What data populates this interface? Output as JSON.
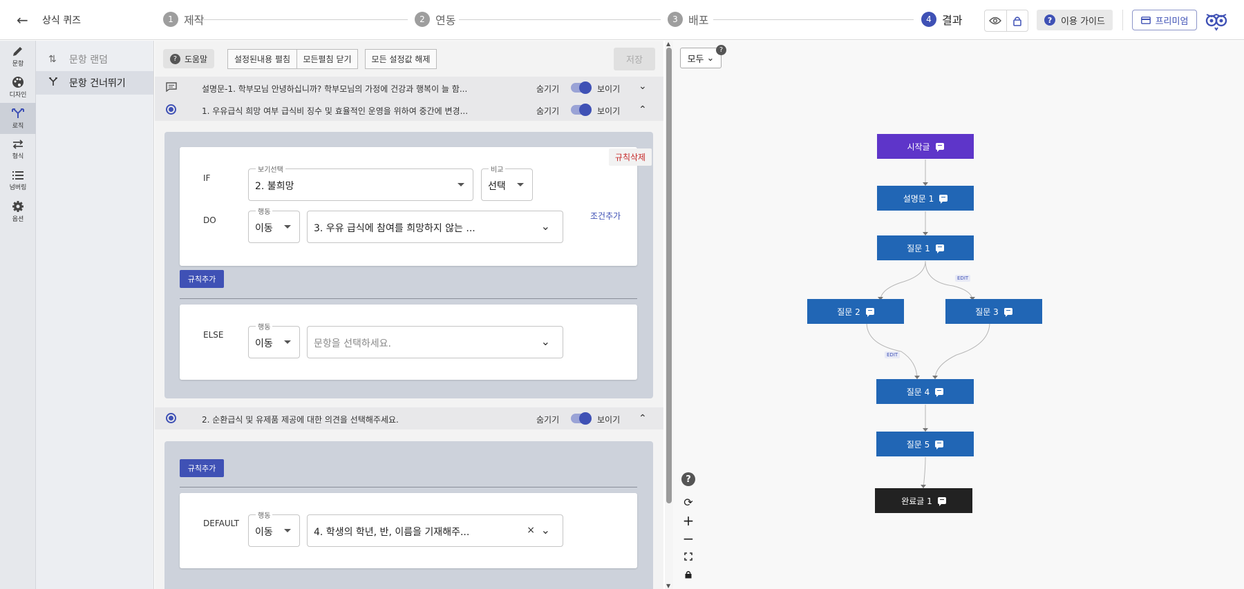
{
  "header": {
    "back_icon": "arrow-left-icon",
    "title": "상식 퀴즈",
    "steps": [
      {
        "num": "1",
        "label": "제작"
      },
      {
        "num": "2",
        "label": "연동"
      },
      {
        "num": "3",
        "label": "배포"
      },
      {
        "num": "4",
        "label": "결과"
      }
    ],
    "active_step": "4",
    "guide_label": "이용 가이드",
    "premium_label": "프리미엄",
    "accent": "#3f51b5"
  },
  "sidenav": {
    "items": [
      {
        "label": "문항",
        "icon": "pencil-icon"
      },
      {
        "label": "디자인",
        "icon": "palette-icon"
      },
      {
        "label": "로직",
        "icon": "branch-icon"
      },
      {
        "label": "형식",
        "icon": "swap-icon"
      },
      {
        "label": "넘버링",
        "icon": "list-icon"
      },
      {
        "label": "옵션",
        "icon": "gear-icon"
      }
    ],
    "active": "로직"
  },
  "subnav": {
    "items": [
      {
        "label": "문항 랜덤",
        "icon": "shuffle-icon"
      },
      {
        "label": "문항 건너뛰기",
        "icon": "skip-icon"
      }
    ]
  },
  "toolbar": {
    "help_label": "도움말",
    "expand_label": "설정된내용 펼침",
    "collapse_label": "모든펼침 닫기",
    "reset_label": "모든 설정값 해제",
    "save_label": "저장"
  },
  "rows": {
    "desc": {
      "text": "설명문-1. 학부모님 안녕하십니까? 학부모님의 가정에 건강과 행복이 늘 함...",
      "hide": "숨기기",
      "show": "보이기"
    },
    "q1": {
      "text": "1. 우유급식 희망 여부 급식비 징수 및 효율적인 운영을 위하여 중간에 변경...",
      "hide": "숨기기",
      "show": "보이기"
    },
    "q2": {
      "text": "2. 순환급식 및 유제품 제공에 대한 의견을 선택해주세요.",
      "hide": "숨기기",
      "show": "보이기"
    }
  },
  "rule1": {
    "delete_label": "규칙삭제",
    "if_label": "IF",
    "select_label": "보기선택",
    "select_value": "2. 불희망",
    "compare_label": "비교",
    "compare_value": "선택",
    "do_label": "DO",
    "action_label": "행동",
    "action_value": "이동",
    "target_value": "3. 우유 급식에 참여를 희망하지 않는 ...",
    "add_condition_label": "조건추가"
  },
  "add_rule_label": "규칙추가",
  "else_block": {
    "else_label": "ELSE",
    "action_label": "행동",
    "action_value": "이동",
    "target_placeholder": "문항을 선택하세요."
  },
  "default_block": {
    "default_label": "DEFAULT",
    "action_label": "행동",
    "action_value": "이동",
    "target_value": "4. 학생의 학년, 반, 이름을 기재해주...",
    "clear_symbol": "×"
  },
  "flow": {
    "filter_value": "모두",
    "nodes": {
      "start": "시작글",
      "desc1": "설명문 1",
      "q1": "질문 1",
      "q2": "질문 2",
      "q3": "질문 3",
      "q4": "질문 4",
      "q5": "질문 5",
      "end": "완료글 1"
    },
    "edit_tag": "EDIT",
    "colors": {
      "start": "#5e35c9",
      "question": "#2166b5",
      "end": "#222222"
    }
  }
}
